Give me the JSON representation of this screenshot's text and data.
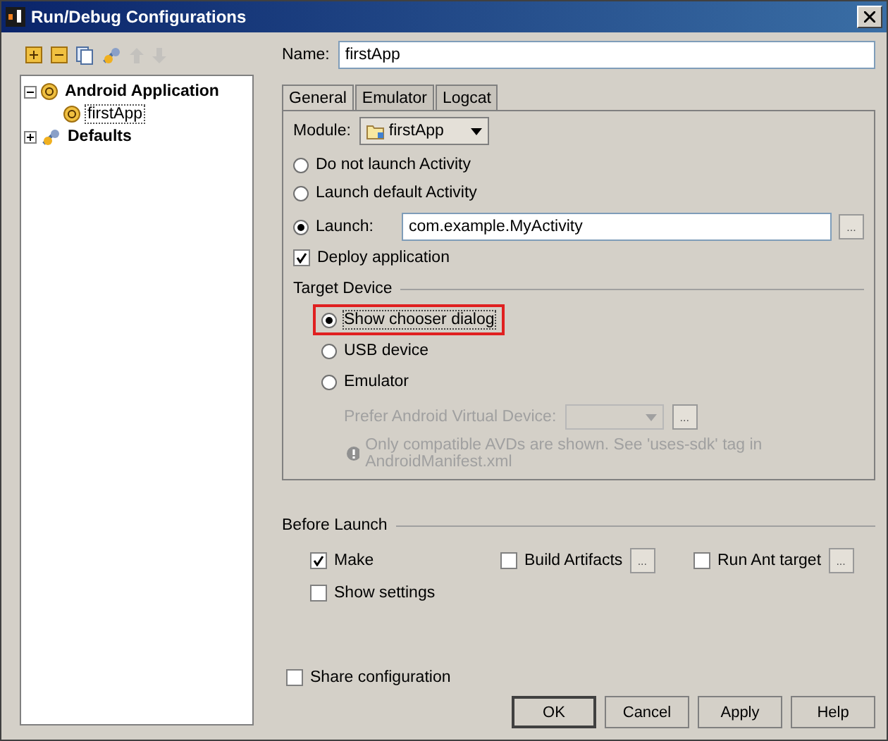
{
  "window": {
    "title": "Run/Debug Configurations"
  },
  "toolbar": [
    {
      "kind": "add",
      "disabled": false
    },
    {
      "kind": "remove",
      "disabled": false
    },
    {
      "kind": "copy",
      "disabled": false
    },
    {
      "kind": "edit",
      "disabled": false
    },
    {
      "kind": "up",
      "disabled": true
    },
    {
      "kind": "down",
      "disabled": true
    }
  ],
  "tree": [
    {
      "label": "Android Application",
      "kind": "android",
      "expanded": true,
      "selected": false,
      "children": [
        {
          "label": "firstApp",
          "kind": "android",
          "selected": true
        }
      ]
    },
    {
      "label": "Defaults",
      "kind": "defaults",
      "expanded": false,
      "selected": false
    }
  ],
  "name": {
    "label": "Name:",
    "value": "firstApp"
  },
  "tabs": [
    {
      "label": "General",
      "selected": true
    },
    {
      "label": "Emulator",
      "selected": false
    },
    {
      "label": "Logcat",
      "selected": false
    }
  ],
  "module": {
    "label": "Module:",
    "value": "firstApp"
  },
  "launch_options": [
    {
      "label": "Do not launch Activity",
      "selected": false
    },
    {
      "label": "Launch default Activity",
      "selected": false
    },
    {
      "label": "Launch:",
      "selected": true,
      "value": "com.example.MyActivity",
      "browse": "..."
    }
  ],
  "deploy": {
    "label": "Deploy application",
    "checked": true
  },
  "target_device": {
    "title": "Target Device",
    "options": [
      {
        "label": "Show chooser dialog",
        "selected": true,
        "highlighted": true
      },
      {
        "label": "USB device",
        "selected": false,
        "highlighted": false
      },
      {
        "label": "Emulator",
        "selected": false,
        "highlighted": false
      }
    ],
    "avd": {
      "label": "Prefer Android Virtual Device:",
      "disabled": true,
      "browse": "..."
    },
    "note": "Only compatible AVDs are shown. See 'uses-sdk' tag in AndroidManifest.xml"
  },
  "before_launch": {
    "title": "Before Launch",
    "items": [
      {
        "label": "Make",
        "checked": true
      },
      {
        "label": "Build Artifacts",
        "checked": false,
        "browse": "..."
      },
      {
        "label": "Run Ant target",
        "checked": false,
        "browse": "..."
      },
      {
        "label": "Show settings",
        "checked": false
      }
    ]
  },
  "share": {
    "label": "Share configuration",
    "checked": false
  },
  "buttons": [
    {
      "label": "OK",
      "default": true
    },
    {
      "label": "Cancel",
      "default": false
    },
    {
      "label": "Apply",
      "default": false
    },
    {
      "label": "Help",
      "default": false
    }
  ]
}
